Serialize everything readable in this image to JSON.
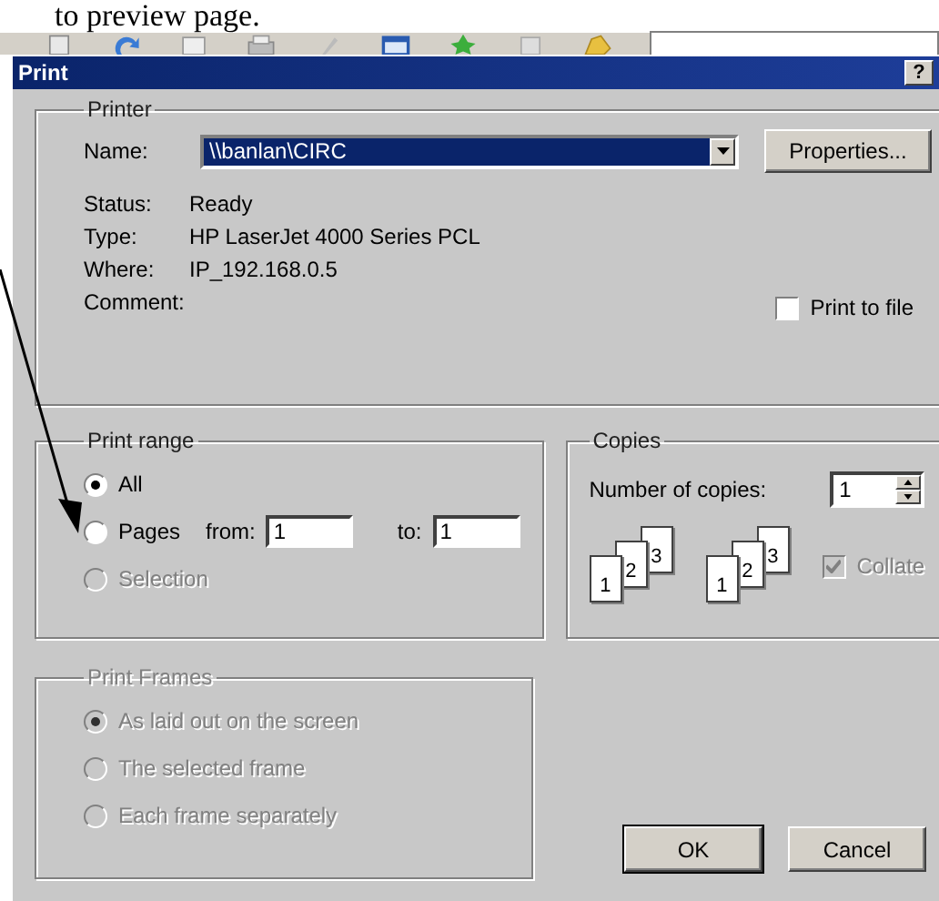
{
  "document": {
    "text": "to preview page."
  },
  "dialog": {
    "title": "Print",
    "help": "?",
    "printer": {
      "legend": "Printer",
      "name_label": "Name:",
      "name_value": "\\\\banlan\\CIRC",
      "properties": "Properties...",
      "info": [
        {
          "label": "Status:",
          "value": "Ready"
        },
        {
          "label": "Type:",
          "value": "HP LaserJet 4000 Series PCL"
        },
        {
          "label": "Where:",
          "value": "IP_192.168.0.5"
        },
        {
          "label": "Comment:"
        }
      ],
      "print_to_file": {
        "label": "Print to file",
        "checked": false
      }
    },
    "print_range": {
      "legend": "Print range",
      "from_label": "from:",
      "from_value": "1",
      "to_label": "to:",
      "to_value": "1",
      "options": [
        {
          "label": "All",
          "selected": true,
          "disabled": false
        },
        {
          "label": "Pages",
          "selected": false,
          "disabled": false
        },
        {
          "label": "Selection",
          "selected": false,
          "disabled": true
        }
      ]
    },
    "copies": {
      "legend": "Copies",
      "number_label": "Number of copies:",
      "number_value": "1",
      "stacks": [
        [
          "1",
          "2",
          "3"
        ],
        [
          "1",
          "2",
          "3"
        ]
      ],
      "collate": {
        "label": "Collate",
        "checked": true,
        "disabled": true
      }
    },
    "print_frames": {
      "legend": "Print Frames",
      "disabled": true,
      "options": [
        {
          "label": "As laid out on the screen",
          "selected": true
        },
        {
          "label": "The selected frame",
          "selected": false
        },
        {
          "label": "Each frame separately",
          "selected": false
        }
      ]
    },
    "buttons": [
      {
        "label": "OK",
        "default": true
      },
      {
        "label": "Cancel",
        "default": false
      }
    ]
  }
}
